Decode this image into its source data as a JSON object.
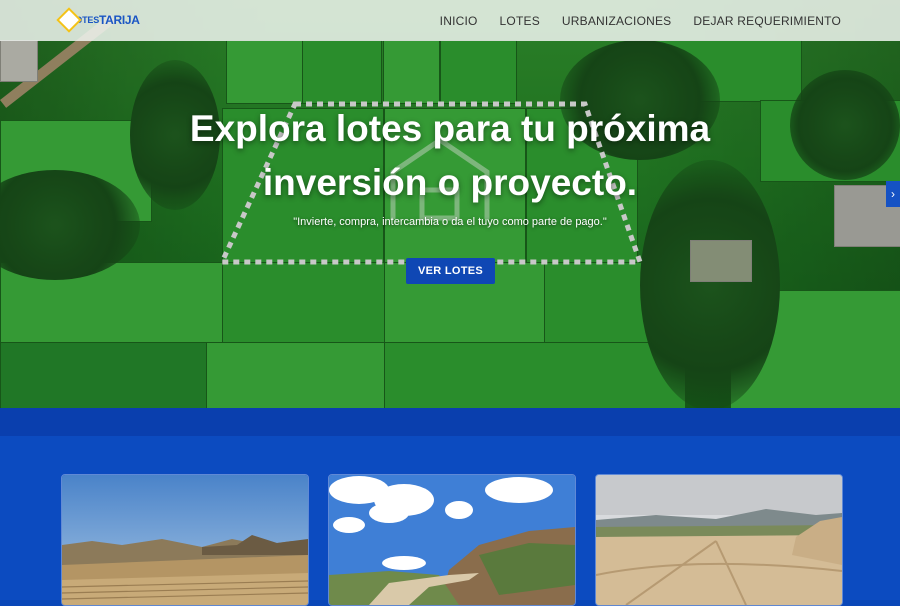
{
  "nav": {
    "logo_small": "LOTES",
    "logo_big": "TARIJA",
    "links": [
      "INICIO",
      "LOTES",
      "URBANIZACIONES",
      "DEJAR REQUERIMIENTO"
    ]
  },
  "hero": {
    "title_line1": "Explora lotes para tu próxima",
    "title_line2": "inversión o proyecto.",
    "subtitle": "\"Invierte, compra, intercambia o da el tuyo como parte de pago.\"",
    "button": "VER LOTES",
    "next_arrow": "›"
  },
  "icons": {
    "hero_arrow": "chevron-right-icon",
    "logo": "diamond-logo-icon"
  },
  "colors": {
    "brand_blue": "#0c4bc0",
    "button_blue": "#0f47b4",
    "logo_yellow": "#f3c218"
  },
  "cards": [
    {
      "name": "land-plot-1"
    },
    {
      "name": "land-plot-2"
    },
    {
      "name": "land-plot-3"
    }
  ]
}
